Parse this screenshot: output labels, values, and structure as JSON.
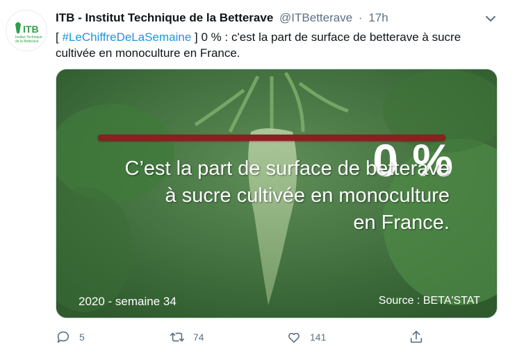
{
  "account": {
    "logo_text": "ITB",
    "logo_subtext_1": "Institut Technique",
    "logo_subtext_2": "de la Betterave",
    "name": "ITB - Institut Technique de la Betterave",
    "handle": "@ITBetterave",
    "separator": "·",
    "time": "17h"
  },
  "tweet": {
    "bracket_open": "[ ",
    "hashtag": "#LeChiffreDeLaSemaine",
    "body": " ] 0 % : c'est la part de surface de betterave à sucre cultivée en monoculture en France."
  },
  "media": {
    "big_value": "0 %",
    "caption_lines": [
      "C’est la part de surface de betterave",
      "à sucre cultivée en monoculture",
      "en France."
    ],
    "year_week": "2020 - semaine 34",
    "source": "Source : BETA'STAT"
  },
  "actions": {
    "reply_count": "5",
    "retweet_count": "74",
    "like_count": "141"
  },
  "icons": {
    "caret": "chevron-down-icon",
    "reply": "reply-icon",
    "retweet": "retweet-icon",
    "like": "heart-icon",
    "share": "share-icon"
  },
  "colors": {
    "link": "#1b95e0",
    "secondary": "#5b7083",
    "logo_green": "#2f9e46",
    "accent_bar": "#8c1f1f"
  }
}
